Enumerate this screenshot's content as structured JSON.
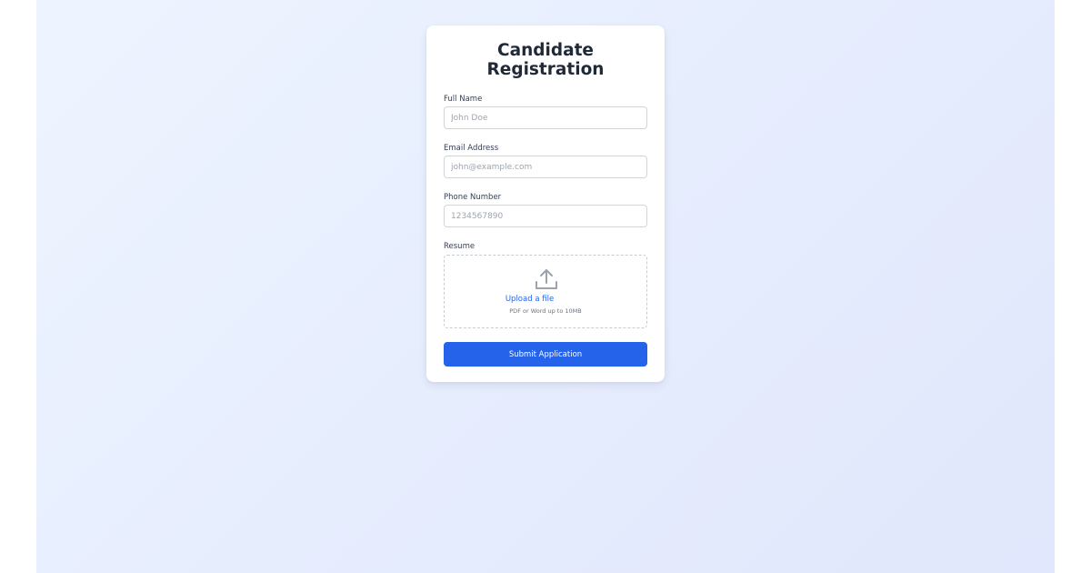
{
  "form": {
    "title": "Candidate Registration",
    "full_name": {
      "label": "Full Name",
      "placeholder": "John Doe",
      "value": ""
    },
    "email": {
      "label": "Email Address",
      "placeholder": "john@example.com",
      "value": ""
    },
    "phone": {
      "label": "Phone Number",
      "placeholder": "1234567890",
      "value": ""
    },
    "resume": {
      "label": "Resume",
      "upload_link": "Upload a file",
      "hint": "PDF or Word up to 10MB",
      "icon": "upload-icon"
    },
    "submit_label": "Submit Application"
  },
  "colors": {
    "accent": "#2563eb",
    "title": "#1f2937",
    "border": "#d1d5db",
    "placeholder": "#9ca3af"
  }
}
